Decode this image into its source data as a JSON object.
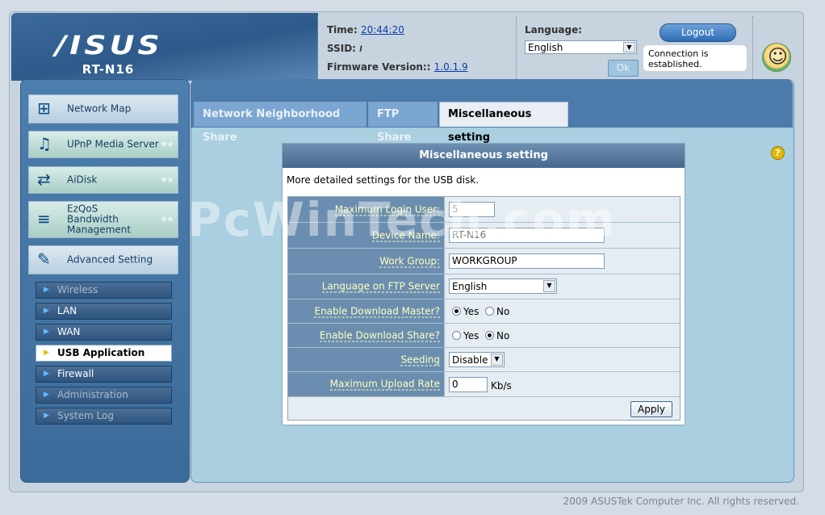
{
  "header": {
    "brand": "/ISUS",
    "model": "RT-N16",
    "time_label": "Time:",
    "time_value": "20:44:20",
    "ssid_label": "SSID:",
    "ssid_value": "l",
    "firmware_label": "Firmware Version::",
    "firmware_value": "1.0.1.9",
    "language_label": "Language:",
    "language_value": "English",
    "ok_label": "Ok",
    "logout_label": "Logout",
    "connection_status": "Connection is established."
  },
  "sidebar": {
    "main_items": [
      {
        "label": "Network Map",
        "icon": "network-map-icon"
      },
      {
        "label": "UPnP Media Server",
        "icon": "media-server-icon"
      },
      {
        "label": "AiDisk",
        "icon": "aidisk-icon"
      },
      {
        "label": "EzQoS Bandwidth Management",
        "icon": "qos-icon"
      },
      {
        "label": "Advanced Setting",
        "icon": "tools-icon"
      }
    ],
    "sub_items": [
      {
        "label": "Wireless"
      },
      {
        "label": "LAN"
      },
      {
        "label": "WAN"
      },
      {
        "label": "USB Application"
      },
      {
        "label": "Firewall"
      },
      {
        "label": "Administration"
      },
      {
        "label": "System Log"
      }
    ]
  },
  "tabs": [
    {
      "label": "Network Neighborhood Share"
    },
    {
      "label": "FTP Share"
    },
    {
      "label": "Miscellaneous setting"
    }
  ],
  "panel": {
    "title": "Miscellaneous setting",
    "description": "More detailed settings for the USB disk.",
    "fields": {
      "max_login_label": "Maximum Login User:",
      "max_login_value": "5",
      "device_name_label": "Device Name:",
      "device_name_value": "RT-N16",
      "work_group_label": "Work Group:",
      "work_group_value": "WORKGROUP",
      "ftp_lang_label": "Language on FTP Server",
      "ftp_lang_value": "English",
      "dl_master_label": "Enable Download Master?",
      "dl_share_label": "Enable Download Share?",
      "yes_label": "Yes",
      "no_label": "No",
      "seeding_label": "Seeding",
      "seeding_value": "Disable",
      "upload_rate_label": "Maximum Upload Rate",
      "upload_rate_value": "0",
      "upload_rate_unit": "Kb/s"
    },
    "apply_label": "Apply"
  },
  "watermark": "PcWinTech.com",
  "footer": "2009 ASUSTek Computer Inc. All rights reserved."
}
